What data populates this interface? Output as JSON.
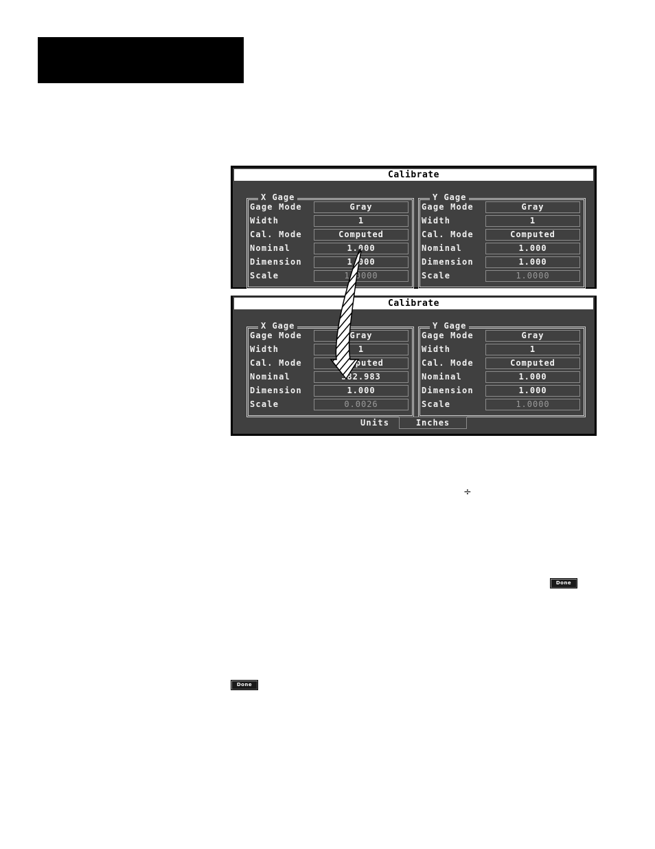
{
  "screens": [
    {
      "title": "Calibrate",
      "gages": [
        {
          "legend": "X Gage",
          "rows": [
            {
              "label": "Gage Mode",
              "value": "Gray",
              "dim": false
            },
            {
              "label": "Width",
              "value": "1",
              "dim": false
            },
            {
              "label": "Cal. Mode",
              "value": "Computed",
              "dim": false
            },
            {
              "label": "Nominal",
              "value": "1.000",
              "dim": false
            },
            {
              "label": "Dimension",
              "value": "1.000",
              "dim": false
            },
            {
              "label": "Scale",
              "value": "1.0000",
              "dim": true
            }
          ]
        },
        {
          "legend": "Y Gage",
          "rows": [
            {
              "label": "Gage Mode",
              "value": "Gray",
              "dim": false
            },
            {
              "label": "Width",
              "value": "1",
              "dim": false
            },
            {
              "label": "Cal. Mode",
              "value": "Computed",
              "dim": false
            },
            {
              "label": "Nominal",
              "value": "1.000",
              "dim": false
            },
            {
              "label": "Dimension",
              "value": "1.000",
              "dim": false
            },
            {
              "label": "Scale",
              "value": "1.0000",
              "dim": true
            }
          ]
        }
      ]
    },
    {
      "title": "Calibrate",
      "gages": [
        {
          "legend": "X Gage",
          "rows": [
            {
              "label": "Gage Mode",
              "value": "Gray",
              "dim": false
            },
            {
              "label": "Width",
              "value": "1",
              "dim": false
            },
            {
              "label": "Cal. Mode",
              "value": "Computed",
              "dim": false
            },
            {
              "label": "Nominal",
              "value": "382.983",
              "dim": false
            },
            {
              "label": "Dimension",
              "value": "1.000",
              "dim": false
            },
            {
              "label": "Scale",
              "value": "0.0026",
              "dim": true
            }
          ]
        },
        {
          "legend": "Y Gage",
          "rows": [
            {
              "label": "Gage Mode",
              "value": "Gray",
              "dim": false
            },
            {
              "label": "Width",
              "value": "1",
              "dim": false
            },
            {
              "label": "Cal. Mode",
              "value": "Computed",
              "dim": false
            },
            {
              "label": "Nominal",
              "value": "1.000",
              "dim": false
            },
            {
              "label": "Dimension",
              "value": "1.000",
              "dim": false
            },
            {
              "label": "Scale",
              "value": "1.0000",
              "dim": true
            }
          ]
        }
      ],
      "units": {
        "label": "Units",
        "value": "Inches"
      }
    }
  ],
  "annotation": {
    "arrow": "hatched-arrow-from-nominal-to-new-nominal"
  },
  "divide_symbol": "÷",
  "buttons": {
    "done_label": "Done"
  }
}
